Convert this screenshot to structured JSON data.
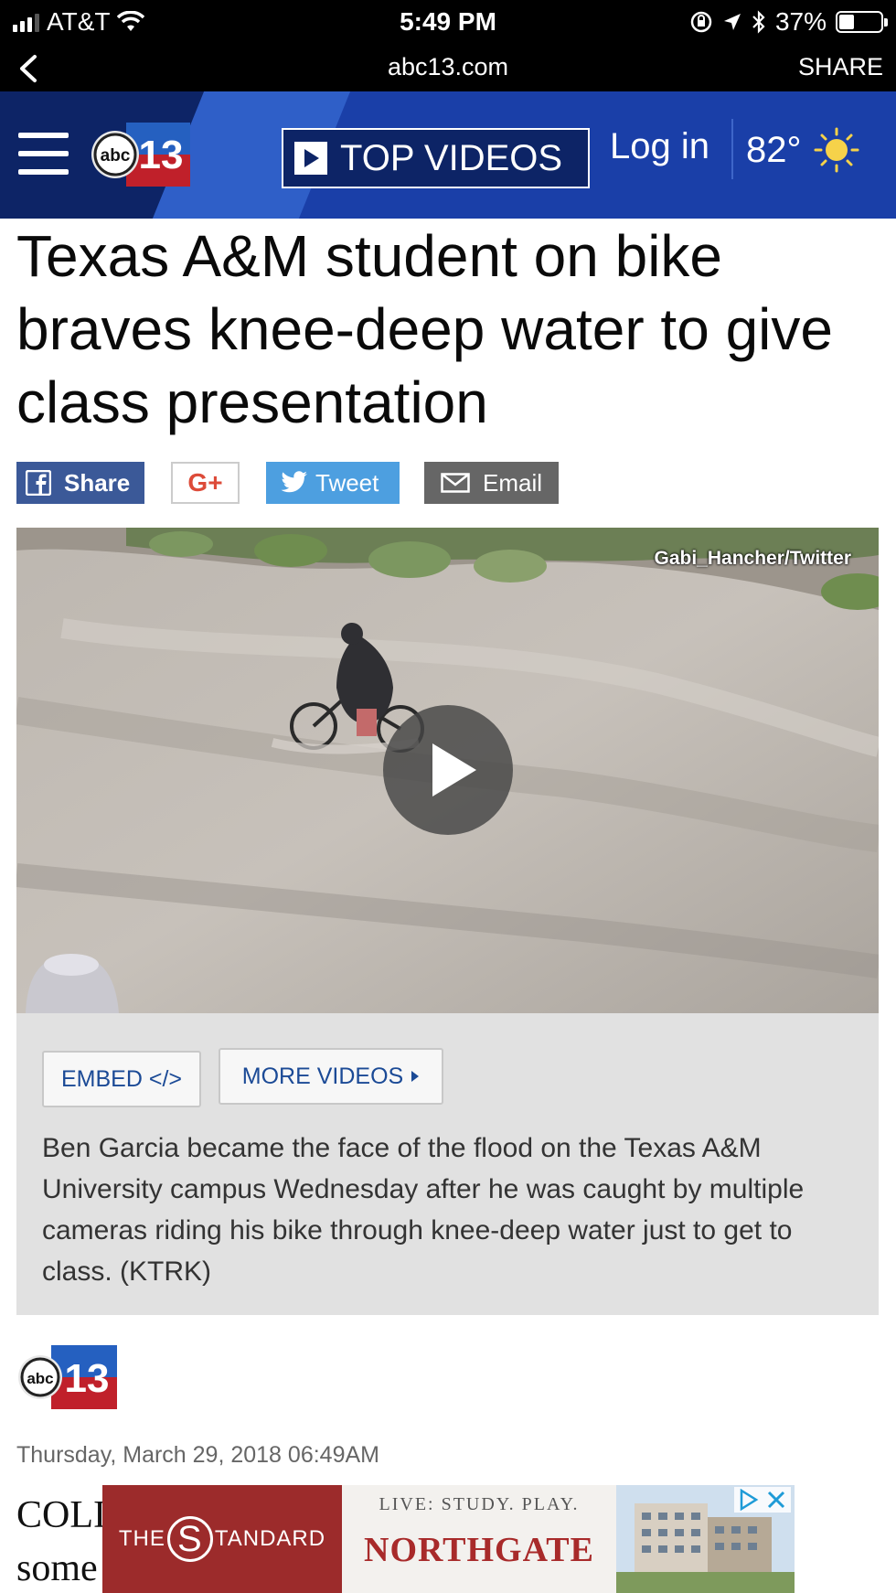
{
  "status_bar": {
    "carrier": "AT&T",
    "time": "5:49 PM",
    "battery_percent": "37%",
    "battery_level": 0.37
  },
  "browser": {
    "url": "abc13.com",
    "share_label": "SHARE"
  },
  "header": {
    "top_videos_label": "TOP VIDEOS",
    "login_label": "Log in",
    "temperature": "82°",
    "logo_text": "abc13"
  },
  "article": {
    "headline": "Texas A&M student on bike braves knee-deep water to give class presentation",
    "share_buttons": {
      "facebook": "Share",
      "google": "G+",
      "twitter": "Tweet",
      "email": "Email"
    },
    "video": {
      "credit": "Gabi_Hancher/Twitter"
    },
    "embed_label": "EMBED </>",
    "more_videos_label": "MORE VIDEOS",
    "caption": "Ben Garcia became the face of the flood on the Texas A&M University campus Wednesday after he was caught by multiple cameras riding his bike through knee-deep water just to get to class. (KTRK)",
    "dateline": "Thursday, March 29, 2018 06:49AM",
    "body_line1": "COLI",
    "body_line2": "some"
  },
  "ad": {
    "brand_prefix": "THE",
    "brand_letter": "S",
    "brand_suffix": "TANDARD",
    "tagline": "LIVE: STUDY. PLAY.",
    "name": "NORTHGATE"
  },
  "colors": {
    "header_blue": "#1a3fa8",
    "header_dark": "#0d2466",
    "facebook": "#3b5998",
    "twitter": "#4d9fe0",
    "link_blue": "#1b4a96",
    "ad_red": "#9c2b2b"
  }
}
